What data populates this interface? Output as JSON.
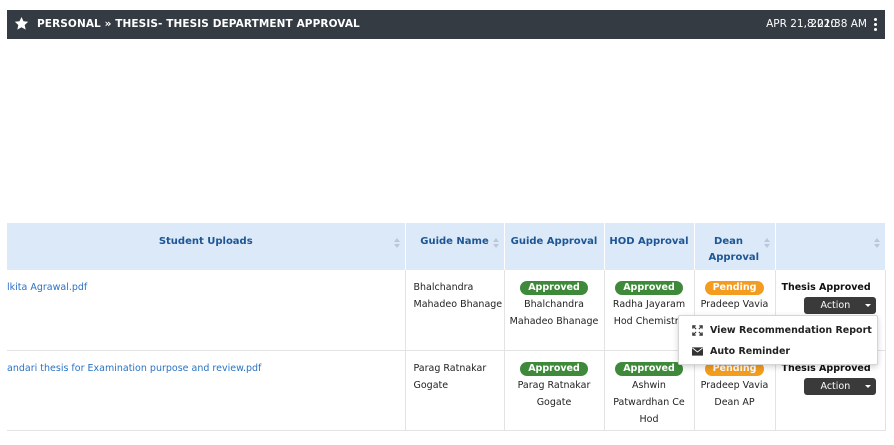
{
  "header": {
    "breadcrumb": "PERSONAL » THESIS- THESIS DEPARTMENT APPROVAL",
    "date": "APR 21, 2020",
    "time": "8:21:38 AM",
    "star_icon": "star-icon",
    "menu_icon": "kebab-menu-icon"
  },
  "table": {
    "columns": [
      "Student Uploads",
      "Guide Name",
      "Guide Approval",
      "HOD Approval",
      "Dean Approval",
      ""
    ],
    "rows": [
      {
        "file": "lkita Agrawal.pdf",
        "guide_name": "Bhalchandra Mahadeo Bhanage",
        "guide_approval": {
          "status": "Approved",
          "by": "Bhalchandra Mahadeo Bhanage"
        },
        "hod_approval": {
          "status": "Approved",
          "by": "Radha Jayaram Hod Chemistry"
        },
        "dean_approval": {
          "status": "Pending",
          "by": "Pradeep Vavia"
        },
        "thesis_status": "Thesis Approved",
        "action_label": "Action"
      },
      {
        "file": "handari thesis for Examination purpose and review.pdf",
        "guide_name": "Parag Ratnakar Gogate",
        "guide_approval": {
          "status": "Approved",
          "by": "Parag Ratnakar Gogate"
        },
        "hod_approval": {
          "status": "Approved",
          "by": "Ashwin Patwardhan Ce Hod"
        },
        "dean_approval": {
          "status": "Pending",
          "by": "Pradeep Vavia Dean AP"
        },
        "thesis_status": "Thesis Approved",
        "action_label": "Action"
      }
    ]
  },
  "action_menu": {
    "items": [
      {
        "label": "View Recommendation Report",
        "icon": "expand-icon"
      },
      {
        "label": "Auto Reminder",
        "icon": "envelope-icon"
      }
    ]
  },
  "colors": {
    "header_bg": "#353b43",
    "table_header_bg": "#dbe9f8",
    "table_header_text": "#1d5595",
    "approved": "#3f8a3a",
    "pending": "#f39c1f",
    "link": "#2a73c4"
  }
}
